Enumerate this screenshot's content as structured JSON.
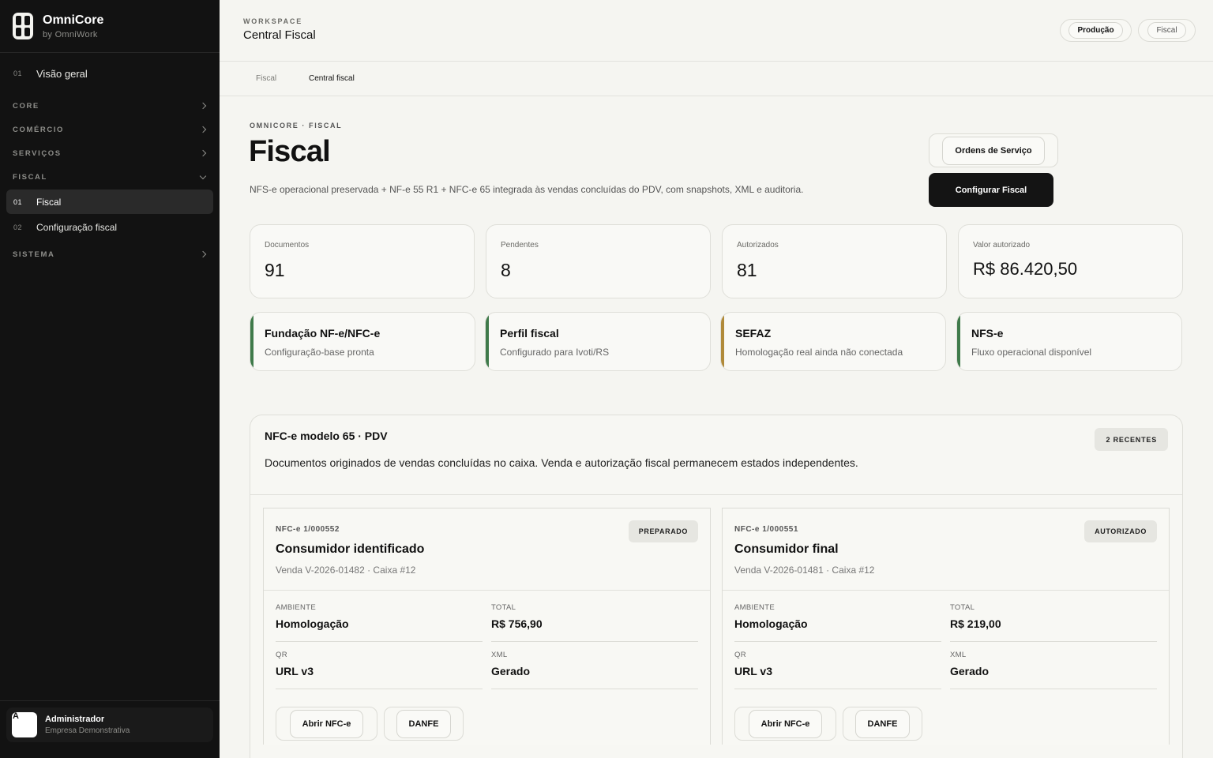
{
  "sidebar": {
    "brand_title": "OmniCore",
    "brand_sub": "by OmniWork",
    "overview": {
      "num": "01",
      "label": "Visão geral"
    },
    "sections": {
      "core": "CORE",
      "comercio": "COMÉRCIO",
      "servicos": "SERVIÇOS",
      "fiscal": "FISCAL",
      "sistema": "SISTEMA"
    },
    "fiscal_items": [
      {
        "num": "01",
        "label": "Fiscal"
      },
      {
        "num": "02",
        "label": "Configuração fiscal"
      }
    ],
    "user": {
      "initial": "A",
      "name": "Administrador",
      "company": "Empresa Demonstrativa"
    }
  },
  "header": {
    "workspace_label": "WORKSPACE",
    "workspace_title": "Central Fiscal",
    "env_pill": "Produção",
    "module_pill": "Fiscal"
  },
  "breadcrumb": [
    "Fiscal",
    "Central fiscal"
  ],
  "page": {
    "eyebrow": "OMNICORE · FISCAL",
    "title": "Fiscal",
    "description": "NFS-e operacional preservada + NF-e 55 R1 + NFC-e 65 integrada às vendas concluídas do PDV, com snapshots, XML e auditoria.",
    "btn_ordens": "Ordens de Serviço",
    "btn_config": "Configurar Fiscal"
  },
  "stats": [
    {
      "label": "Documentos",
      "value": "91"
    },
    {
      "label": "Pendentes",
      "value": "8"
    },
    {
      "label": "Autorizados",
      "value": "81"
    },
    {
      "label": "Valor autorizado",
      "value": "R$ 86.420,50"
    }
  ],
  "status_cards": [
    {
      "title": "Fundação NF-e/NFC-e",
      "sub": "Configuração-base pronta",
      "color": "#3f7a4a"
    },
    {
      "title": "Perfil fiscal",
      "sub": "Configurado para Ivoti/RS",
      "color": "#3f7a4a"
    },
    {
      "title": "SEFAZ",
      "sub": "Homologação real ainda não conectada",
      "color": "#b08a3a"
    },
    {
      "title": "NFS-e",
      "sub": "Fluxo operacional disponível",
      "color": "#3f7a4a"
    }
  ],
  "nfce": {
    "title": "NFC-e modelo 65 · PDV",
    "badge": "2 RECENTES",
    "description": "Documentos originados de vendas concluídas no caixa. Venda e autorização fiscal permanecem estados independentes.",
    "docs": [
      {
        "number": "NFC-e 1/000552",
        "title": "Consumidor identificado",
        "sub": "Venda V-2026-01482 · Caixa #12",
        "status": "PREPARADO",
        "ambiente_label": "AMBIENTE",
        "ambiente": "Homologação",
        "total_label": "TOTAL",
        "total": "R$ 756,90",
        "qr_label": "QR",
        "qr": "URL v3",
        "xml_label": "XML",
        "xml": "Gerado",
        "btn_open": "Abrir NFC-e",
        "btn_danfe": "DANFE"
      },
      {
        "number": "NFC-e 1/000551",
        "title": "Consumidor final",
        "sub": "Venda V-2026-01481 · Caixa #12",
        "status": "AUTORIZADO",
        "ambiente_label": "AMBIENTE",
        "ambiente": "Homologação",
        "total_label": "TOTAL",
        "total": "R$ 219,00",
        "qr_label": "QR",
        "qr": "URL v3",
        "xml_label": "XML",
        "xml": "Gerado",
        "btn_open": "Abrir NFC-e",
        "btn_danfe": "DANFE"
      }
    ]
  }
}
